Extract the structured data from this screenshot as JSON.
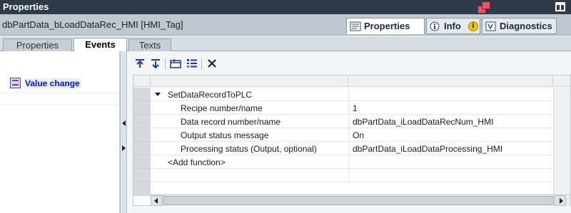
{
  "window": {
    "title": "Properties"
  },
  "object": {
    "name": "dbPartData_bLoadDataRec_HMI [HMI_Tag]"
  },
  "inspector_tabs": [
    {
      "label": "Properties",
      "icon": "properties-icon",
      "active": true
    },
    {
      "label": "Info",
      "icon": "info-icon",
      "active": false
    },
    {
      "label": "Diagnostics",
      "icon": "diagnostics-icon",
      "active": false
    }
  ],
  "sub_tabs": [
    {
      "label": "Properties",
      "active": false
    },
    {
      "label": "Events",
      "active": true
    },
    {
      "label": "Texts",
      "active": false
    }
  ],
  "events": [
    {
      "label": "Value change",
      "icon": "event-icon",
      "selected": true
    }
  ],
  "toolbar": {
    "buttons": [
      "move-up-icon",
      "move-down-icon",
      "add-folder-icon",
      "list-icon",
      "delete-icon"
    ]
  },
  "function_list": {
    "function_name": "SetDataRecordToPLC",
    "parameters": [
      {
        "name": "Recipe number/name",
        "value": "1"
      },
      {
        "name": "Data record number/name",
        "value": "dbPartData_iLoadDataRecNum_HMI"
      },
      {
        "name": "Output status message",
        "value": "On"
      },
      {
        "name": "Processing status (Output, optional)",
        "value": "dbPartData_iLoadDataProcessing_HMI"
      }
    ],
    "add_function_label": "<Add function>"
  },
  "colors": {
    "titlebar": "#2e3c49",
    "accent_link": "#0014c8"
  }
}
